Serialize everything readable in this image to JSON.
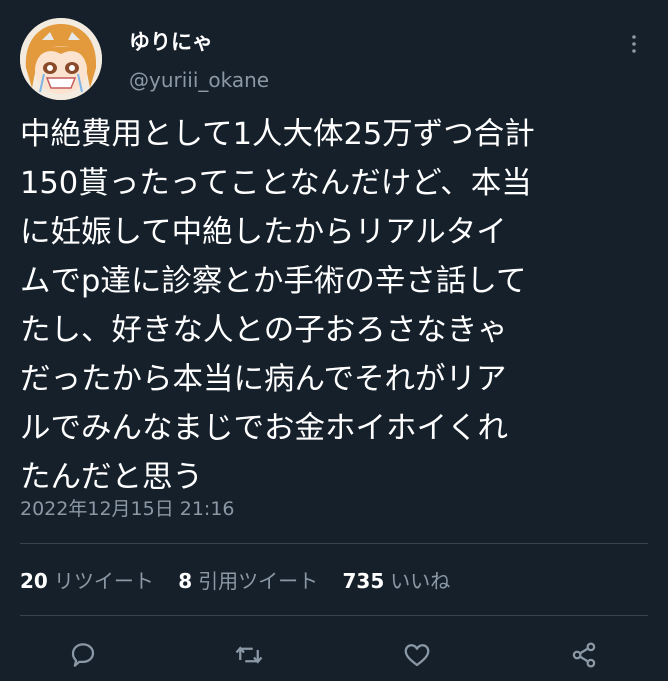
{
  "author": {
    "display_name": "ゆりにゃ",
    "handle": "@yuriii_okane",
    "avatar_icon": "anime-girl-avatar-icon"
  },
  "tweet": {
    "text": "中絶費用として1人大体25万ずつ合計\n150貰ったってことなんだけど、本当\nに妊娠して中絶したからリアルタイ\nムでp達に診察とか手術の辛さ話して\nたし、好きな人との子おろさなきゃ\nだったから本当に病んでそれがリア\nルでみんなまじでお金ホイホイくれ\nたんだと思う",
    "timestamp": "2022年12月15日 21:16"
  },
  "stats": {
    "retweets_count": "20",
    "retweets_label": "リツイート",
    "quotes_count": "8",
    "quotes_label": "引用ツイート",
    "likes_count": "735",
    "likes_label": "いいね"
  },
  "actions": [
    "reply-icon",
    "retweet-icon",
    "like-icon",
    "share-icon"
  ],
  "colors": {
    "background": "#15202b",
    "text_primary": "#ffffff",
    "text_secondary": "#8b98a5",
    "divider": "#38444d"
  }
}
